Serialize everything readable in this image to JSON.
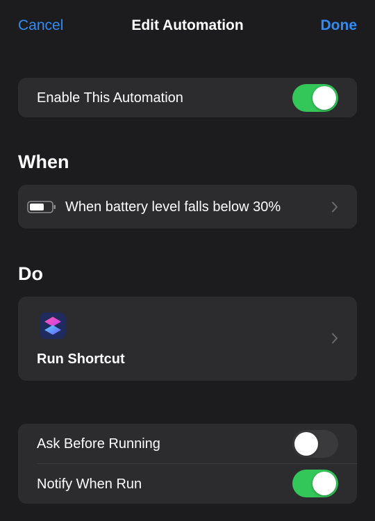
{
  "nav": {
    "cancel_label": "Cancel",
    "title": "Edit Automation",
    "done_label": "Done"
  },
  "enable": {
    "label": "Enable This Automation",
    "on": true
  },
  "when": {
    "header": "When",
    "trigger": {
      "icon": "battery-icon",
      "label": "When battery level falls below 30%"
    }
  },
  "do": {
    "header": "Do",
    "action": {
      "icon": "shortcuts-app-icon",
      "label": "Run Shortcut"
    }
  },
  "options": [
    {
      "label": "Ask Before Running",
      "on": false
    },
    {
      "label": "Notify When Run",
      "on": true
    }
  ],
  "colors": {
    "accent": "#2f8cf5",
    "toggle_on": "#33c659",
    "background": "#1c1c1e",
    "card": "#2c2c2e"
  }
}
